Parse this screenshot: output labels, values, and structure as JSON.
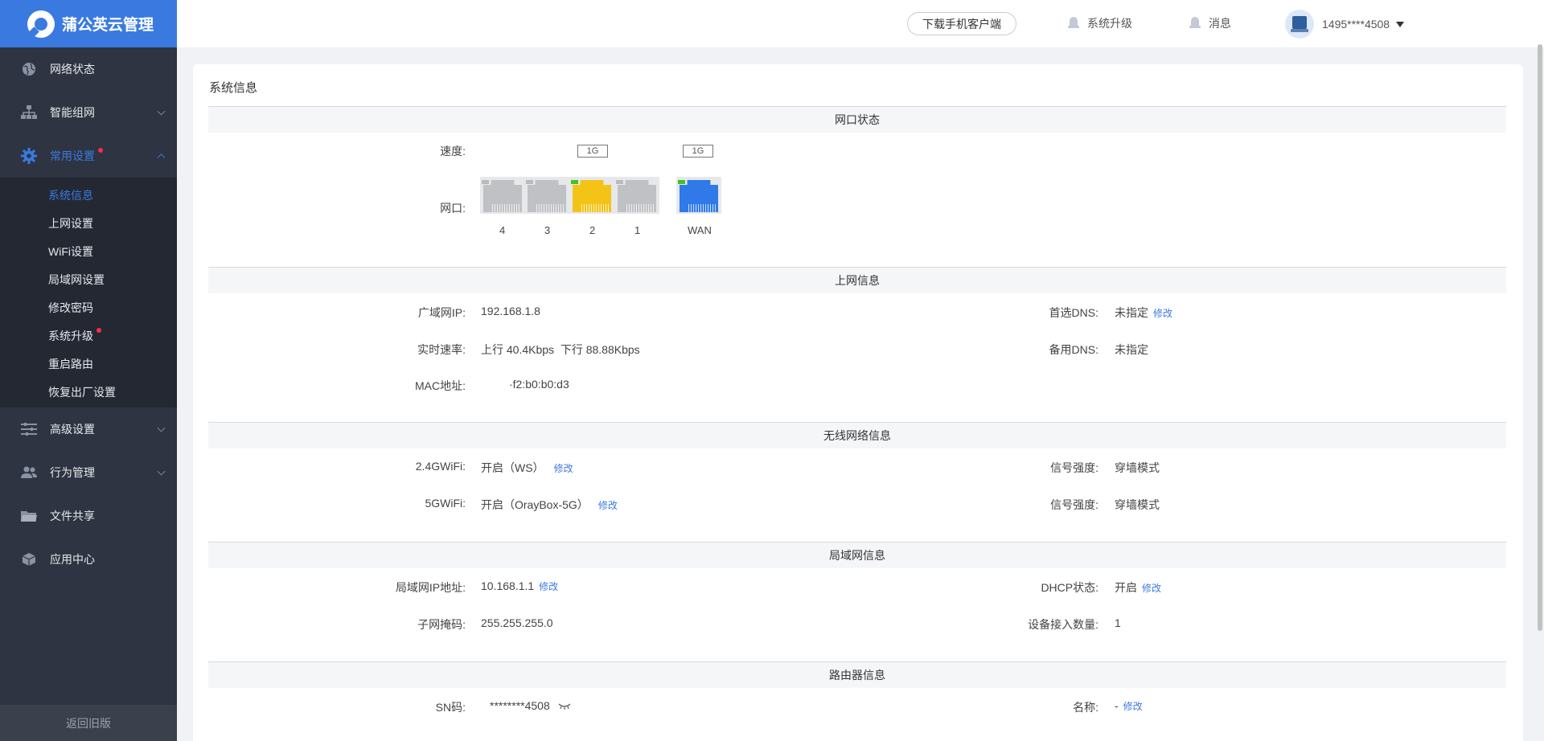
{
  "brand": {
    "name": "蒲公英云管理"
  },
  "sidebar": {
    "items": [
      {
        "label": "网络状态",
        "icon": "globe-icon"
      },
      {
        "label": "智能组网",
        "icon": "network-icon"
      },
      {
        "label": "常用设置",
        "icon": "gear-icon",
        "active": true,
        "badge": true
      },
      {
        "label": "高级设置",
        "icon": "sliders-icon"
      },
      {
        "label": "行为管理",
        "icon": "users-icon"
      },
      {
        "label": "文件共享",
        "icon": "folder-icon"
      },
      {
        "label": "应用中心",
        "icon": "cube-icon"
      }
    ],
    "submenu": [
      {
        "label": "系统信息",
        "active": true
      },
      {
        "label": "上网设置"
      },
      {
        "label": "WiFi设置"
      },
      {
        "label": "局域网设置"
      },
      {
        "label": "修改密码"
      },
      {
        "label": "系统升级",
        "badge": true
      },
      {
        "label": "重启路由"
      },
      {
        "label": "恢复出厂设置"
      }
    ],
    "back_label": "返回旧版"
  },
  "header": {
    "download_label": "下载手机客户端",
    "upgrade_label": "系统升级",
    "message_label": "消息",
    "user_name": "1495****4508"
  },
  "main": {
    "title": "系统信息",
    "port_status": {
      "heading": "网口状态",
      "speed_label": "速度:",
      "port_label": "网口:",
      "lan_speed": "1G",
      "wan_speed": "1G",
      "ports": [
        {
          "num": "4",
          "color": "#bfc1c4",
          "led": "#b8babd"
        },
        {
          "num": "3",
          "color": "#bfc1c4",
          "led": "#b8babd"
        },
        {
          "num": "2",
          "color": "#f3c318",
          "led": "#43c21f"
        },
        {
          "num": "1",
          "color": "#bfc1c4",
          "led": "#b8babd"
        }
      ],
      "wan": {
        "num": "WAN",
        "color": "#2f7ae8",
        "led": "#43c21f"
      }
    },
    "internet": {
      "heading": "上网信息",
      "wan_ip_label": "广域网IP:",
      "wan_ip": "192.168.1.8",
      "rate_label": "实时速率:",
      "rate": "上行 40.4Kbps  下行 88.88Kbps",
      "mac_label": "MAC地址:",
      "mac": "·f2:b0:b0:d3",
      "dns1_label": "首选DNS:",
      "dns1": "未指定",
      "dns1_edit": "修改",
      "dns2_label": "备用DNS:",
      "dns2": "未指定"
    },
    "wireless": {
      "heading": "无线网络信息",
      "w24_label": "2.4GWiFi:",
      "w24": "开启（WS）",
      "w24_edit": "修改",
      "w5_label": "5GWiFi:",
      "w5": "开启（OrayBox-5G）",
      "w5_edit": "修改",
      "sig1_label": "信号强度:",
      "sig1": "穿墙模式",
      "sig2_label": "信号强度:",
      "sig2": "穿墙模式"
    },
    "lan": {
      "heading": "局域网信息",
      "ip_label": "局域网IP地址:",
      "ip": "10.168.1.1",
      "ip_edit": "修改",
      "mask_label": "子网掩码:",
      "mask": "255.255.255.0",
      "dhcp_label": "DHCP状态:",
      "dhcp": "开启",
      "dhcp_edit": "修改",
      "devices_label": "设备接入数量:",
      "devices": "1"
    },
    "router": {
      "heading": "路由器信息",
      "sn_label": "SN码:",
      "sn": "********4508",
      "name_label": "名称:",
      "name": "-",
      "name_edit": "修改"
    }
  }
}
